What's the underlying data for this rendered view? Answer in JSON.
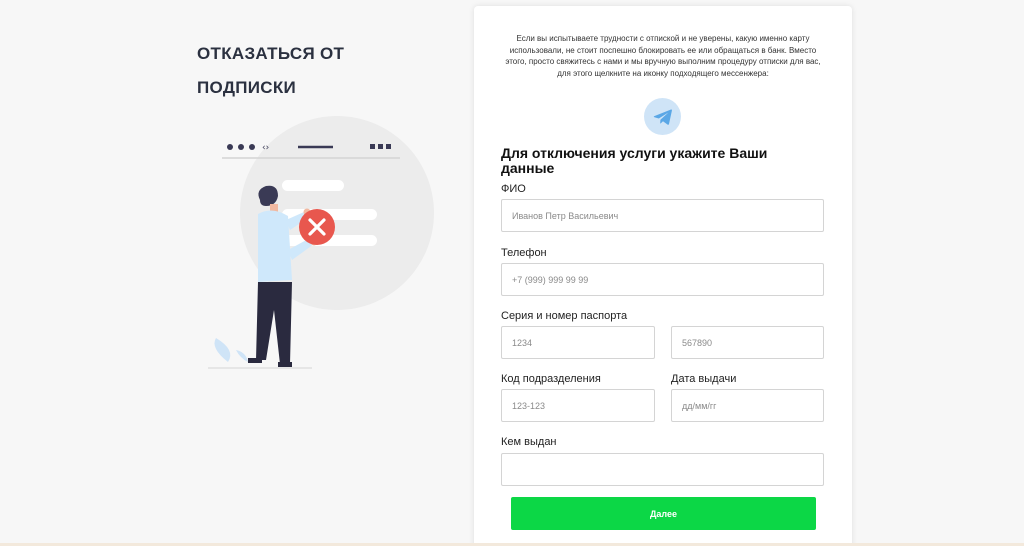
{
  "page": {
    "heading": "ОТКАЗАТЬСЯ ОТ ПОДПИСКИ"
  },
  "colors": {
    "accent_green": "#0cd746",
    "heading": "#2b3140",
    "telegram": "#5aa7e6",
    "cancel_red": "#e8574e"
  },
  "illustration": {
    "icon": "person-cancel-subscription-illustration",
    "browser_arrows": "‹›"
  },
  "form": {
    "intro": "Если вы испытываете трудности с отпиской и не уверены, какую именно карту использовали, не стоит поспешно блокировать ее или обращаться в банк. Вместо этого, просто свяжитесь с нами и мы вручную выполним процедуру отписки для вас, для этого щелкните на иконку подходящего мессенжера:",
    "messenger_icon": "telegram-icon",
    "title": "Для отключения услуги укажите Ваши данные",
    "fields": {
      "fio": {
        "label": "ФИО",
        "placeholder": "Иванов Петр Васильевич",
        "value": ""
      },
      "phone": {
        "label": "Телефон",
        "placeholder": "+7 (999) 999 99 99",
        "value": ""
      },
      "passport": {
        "label": "Серия и номер паспорта",
        "series_placeholder": "1234",
        "number_placeholder": "567890"
      },
      "division_code": {
        "label": "Код подразделения",
        "placeholder": "123-123"
      },
      "issue_date": {
        "label": "Дата выдачи",
        "placeholder": "дд/мм/гг"
      },
      "issued_by": {
        "label": "Кем выдан",
        "placeholder": "",
        "value": ""
      }
    },
    "submit_label": "Далее"
  }
}
